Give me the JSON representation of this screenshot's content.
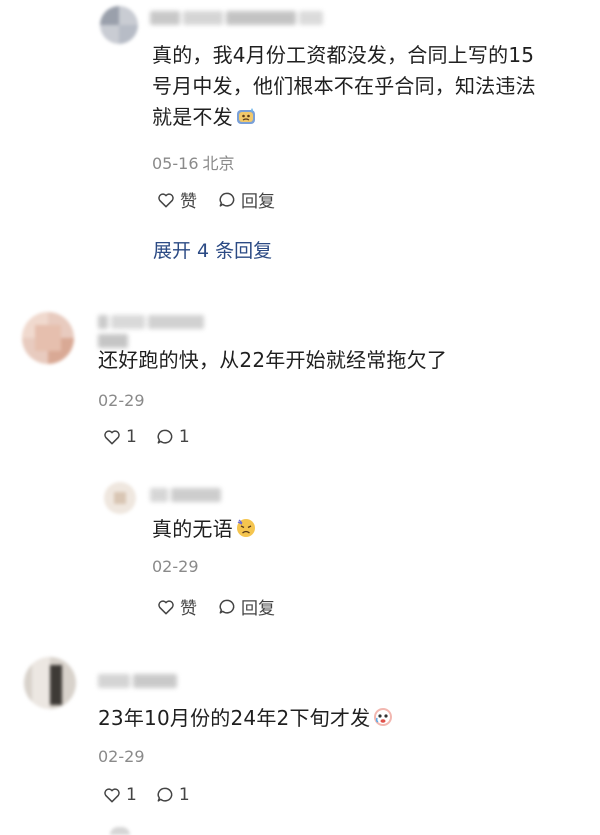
{
  "comments": [
    {
      "text": "真的，我4月份工资都没发，合同上写的15号月中发，他们根本不在乎合同，知法违法就是不发",
      "text_lines": [
        "真的，我4月份工资都没发，合同上写的15",
        "号月中发，他们根本不在乎合同，知法违法",
        "就是不发"
      ],
      "date": "05-16",
      "location": "北京",
      "like_label": "赞",
      "reply_label": "回复",
      "expand_label": "展开 4 条回复",
      "emoji_icon": "sweat-face-icon"
    },
    {
      "text": "还好跑的快，从22年开始就经常拖欠了",
      "date": "02-29",
      "like_count": "1",
      "reply_count": "1"
    },
    {
      "text": "真的无语",
      "date": "02-29",
      "like_label": "赞",
      "reply_label": "回复",
      "emoji_icon": "weary-face-icon"
    },
    {
      "text": "23年10月份的24年2下旬才发",
      "date": "02-29",
      "like_count": "1",
      "reply_count": "1",
      "emoji_icon": "crying-face-icon"
    }
  ],
  "colors": {
    "text": "#1f1f1f",
    "meta": "#8a8a8a",
    "link": "#2b4a84",
    "icon": "#444444"
  }
}
